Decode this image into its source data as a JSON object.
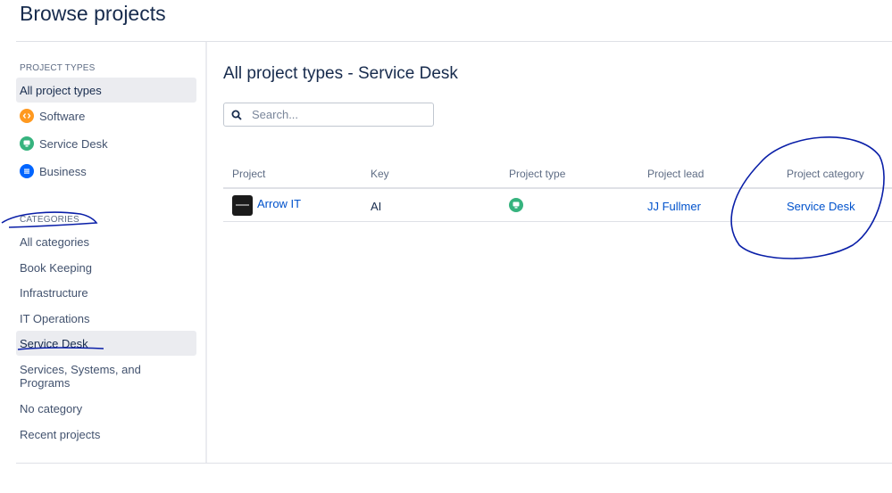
{
  "page": {
    "title": "Browse projects"
  },
  "sidebar": {
    "project_types_heading": "PROJECT TYPES",
    "project_types": [
      {
        "label": "All project types",
        "icon": "none",
        "selected": true
      },
      {
        "label": "Software",
        "icon": "software-icon",
        "color": "#ff991f"
      },
      {
        "label": "Service Desk",
        "icon": "service-desk-icon",
        "color": "#36b37e"
      },
      {
        "label": "Business",
        "icon": "business-icon",
        "color": "#0065ff"
      }
    ],
    "categories_heading": "CATEGORIES",
    "categories": [
      {
        "label": "All categories"
      },
      {
        "label": "Book Keeping"
      },
      {
        "label": "Infrastructure"
      },
      {
        "label": "IT Operations"
      },
      {
        "label": "Service Desk",
        "selected": true
      },
      {
        "label": "Services, Systems, and Programs"
      },
      {
        "label": "No category"
      },
      {
        "label": "Recent projects"
      }
    ]
  },
  "main": {
    "title": "All project types - Service Desk",
    "search": {
      "placeholder": "Search...",
      "value": ""
    },
    "table": {
      "columns": [
        "Project",
        "Key",
        "Project type",
        "Project lead",
        "Project category"
      ],
      "rows": [
        {
          "project": "Arrow IT",
          "key": "AI",
          "project_type_icon": "service-desk-icon",
          "lead": "JJ Fullmer",
          "category": "Service Desk"
        }
      ]
    }
  },
  "colors": {
    "link": "#0052cc",
    "annotation": "#0a1fa8",
    "selected_bg": "#ebecf0"
  }
}
